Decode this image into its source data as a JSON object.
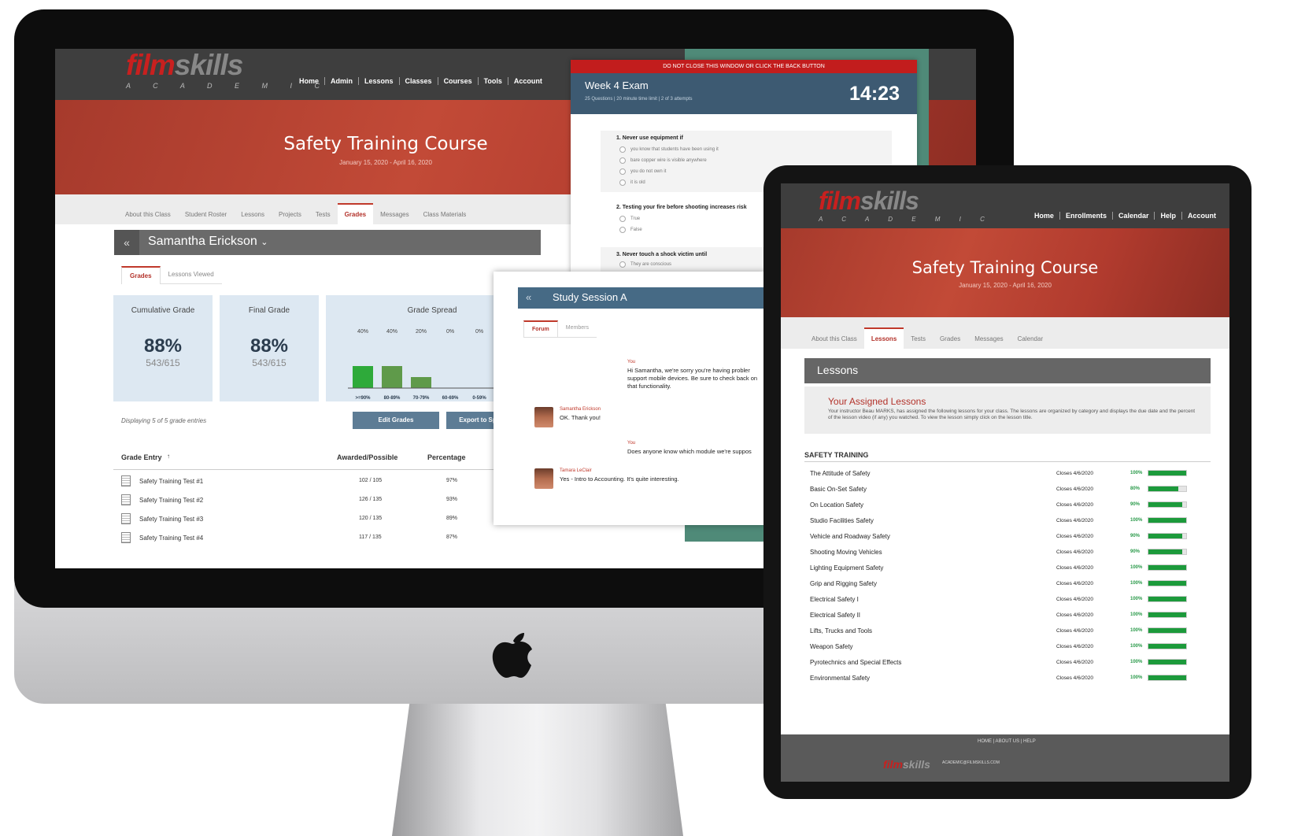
{
  "brand": {
    "logo_main": "film",
    "logo_accent": "skills",
    "logo_sub": "A C A D E M I C"
  },
  "desktop": {
    "nav": [
      "Home",
      "Admin",
      "Lessons",
      "Classes",
      "Courses",
      "Tools",
      "Account"
    ],
    "course_title": "Safety Training Course",
    "course_dates": "January 15, 2020 - April 16, 2020",
    "tabs": [
      "About this Class",
      "Student Roster",
      "Lessons",
      "Projects",
      "Tests",
      "Grades",
      "Messages",
      "Class Materials"
    ],
    "active_tab": "Grades",
    "student_name": "Samantha Erickson",
    "subtabs": [
      "Grades",
      "Lessons Viewed"
    ],
    "cumulative": {
      "title": "Cumulative Grade",
      "pct": "88%",
      "frac": "543/615"
    },
    "final": {
      "title": "Final Grade",
      "pct": "88%",
      "frac": "543/615"
    },
    "spread_title": "Grade Spread",
    "display_text": "Displaying 5 of 5 grade entries",
    "edit_button": "Edit Grades",
    "export_button": "Export to Sp",
    "table_headers": {
      "entry": "Grade Entry",
      "awarded": "Awarded/Possible",
      "percentage": "Percentage"
    },
    "rows": [
      {
        "name": "Safety Training Test #1",
        "awarded": "102 / 105",
        "pct": "97%"
      },
      {
        "name": "Safety Training Test #2",
        "awarded": "126 / 135",
        "pct": "93%"
      },
      {
        "name": "Safety Training Test #3",
        "awarded": "120 / 135",
        "pct": "89%"
      },
      {
        "name": "Safety Training Test #4",
        "awarded": "117 / 135",
        "pct": "87%"
      }
    ]
  },
  "chart_data": {
    "type": "bar",
    "title": "Grade Spread",
    "categories": [
      ">=90%",
      "80-89%",
      "70-79%",
      "60-69%",
      "0-59%"
    ],
    "values": [
      40,
      40,
      20,
      0,
      0
    ],
    "value_labels": [
      "40%",
      "40%",
      "20%",
      "0%",
      "0%"
    ],
    "ylim": [
      0,
      100
    ],
    "colors": {
      "top": "#2eaa3a",
      "mid": "#5f9a4a"
    }
  },
  "exam": {
    "warning": "DO NOT CLOSE THIS WINDOW OR CLICK THE BACK BUTTON",
    "title": "Week 4 Exam",
    "subtitle": "25 Questions  |  20 minute time limit  |  2 of 3 attempts",
    "timer": "14:23",
    "q1": "1. Never use equipment if",
    "q1_opts": [
      "you know that students have been using it",
      "bare copper wire is visible anywhere",
      "you do not own it",
      "it is old"
    ],
    "q2": "2. Testing your fire before shooting increases risk",
    "q2_opts": [
      "True",
      "False"
    ],
    "q3": "3. Never touch a shock victim until",
    "q3_opts": [
      "They are conscious"
    ]
  },
  "study": {
    "title": "Study Session A",
    "tabs": [
      "Forum",
      "Members"
    ],
    "messages": [
      {
        "who": "You",
        "text": "Hi Samantha, we're sorry you're having probler support mobile devices. Be sure to check back on that functionality."
      },
      {
        "who": "Samantha Erickson",
        "text": "OK. Thank you!"
      },
      {
        "who": "You",
        "text": "Does anyone know which module we're suppos"
      },
      {
        "who": "Tamara LeClair",
        "text": "Yes - Intro to Accounting. It's quite interesting."
      }
    ]
  },
  "tablet": {
    "nav": [
      "Home",
      "Enrollments",
      "Calendar",
      "Help",
      "Account"
    ],
    "course_title": "Safety Training Course",
    "course_dates": "January 15, 2020 - April 16, 2020",
    "tabs": [
      "About this Class",
      "Lessons",
      "Tests",
      "Grades",
      "Messages",
      "Calendar"
    ],
    "lessons_header": "Lessons",
    "assigned_title": "Your Assigned Lessons",
    "assigned_text": "Your instructor Beau MARKS, has assigned the following lessons for your class. The lessons are organized by category and displays the due date and the percent of the lesson video (if any) you watched. To view the lesson simply click on the lesson title.",
    "section": "SAFETY TRAINING",
    "lessons": [
      {
        "name": "The Attitude of Safety",
        "closes": "Closes 4/6/2020",
        "pct": "100%",
        "v": 100
      },
      {
        "name": "Basic On-Set Safety",
        "closes": "Closes 4/6/2020",
        "pct": "80%",
        "v": 80
      },
      {
        "name": "On Location Safety",
        "closes": "Closes 4/6/2020",
        "pct": "90%",
        "v": 90
      },
      {
        "name": "Studio Facilities Safety",
        "closes": "Closes 4/6/2020",
        "pct": "100%",
        "v": 100
      },
      {
        "name": "Vehicle and Roadway Safety",
        "closes": "Closes 4/6/2020",
        "pct": "90%",
        "v": 90
      },
      {
        "name": "Shooting Moving Vehicles",
        "closes": "Closes 4/6/2020",
        "pct": "90%",
        "v": 90
      },
      {
        "name": "Lighting Equipment Safety",
        "closes": "Closes 4/6/2020",
        "pct": "100%",
        "v": 100
      },
      {
        "name": "Grip and Rigging Safety",
        "closes": "Closes 4/6/2020",
        "pct": "100%",
        "v": 100
      },
      {
        "name": "Electrical Safety I",
        "closes": "Closes 4/6/2020",
        "pct": "100%",
        "v": 100
      },
      {
        "name": "Electrical Safety II",
        "closes": "Closes 4/6/2020",
        "pct": "100%",
        "v": 100
      },
      {
        "name": "Lifts, Trucks and Tools",
        "closes": "Closes 4/6/2020",
        "pct": "100%",
        "v": 100
      },
      {
        "name": "Weapon Safety",
        "closes": "Closes 4/6/2020",
        "pct": "100%",
        "v": 100
      },
      {
        "name": "Pyrotechnics and Special Effects",
        "closes": "Closes 4/6/2020",
        "pct": "100%",
        "v": 100
      },
      {
        "name": "Environmental Safety",
        "closes": "Closes 4/6/2020",
        "pct": "100%",
        "v": 100
      }
    ],
    "footer_links": "HOME  |  ABOUT US  |  HELP",
    "footer_email": "ACADEMIC@FILMSKILLS.COM"
  }
}
